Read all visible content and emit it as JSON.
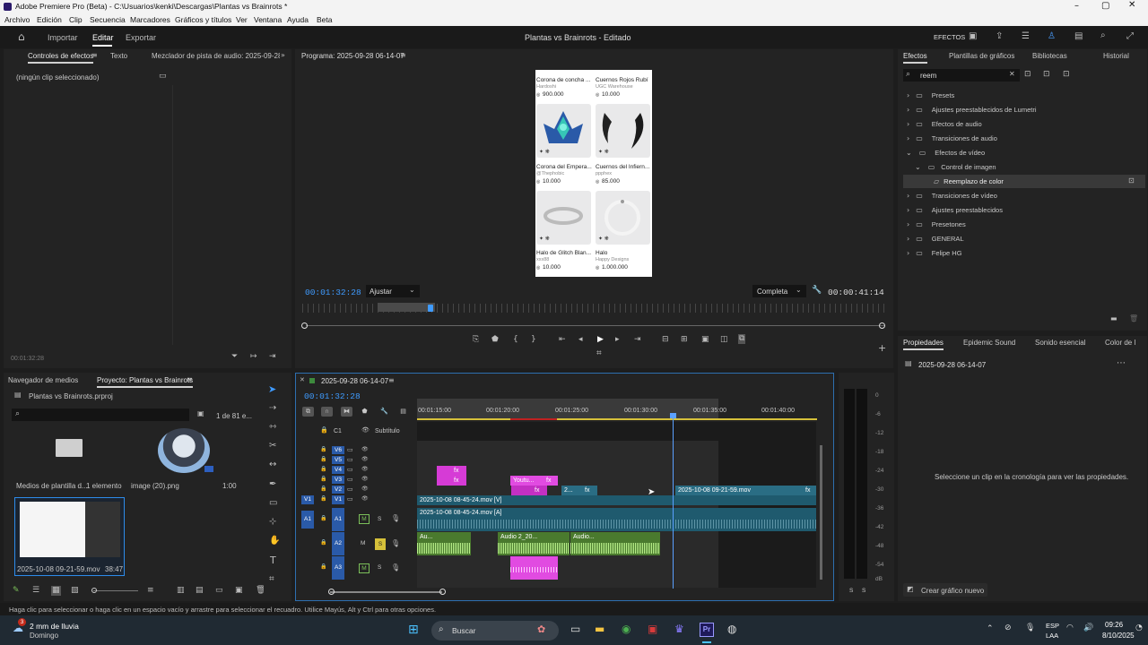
{
  "window": {
    "title": "Adobe Premiere Pro (Beta) - C:\\Usuarios\\kenki\\Descargas\\Plantas vs Brainrots *",
    "menu": [
      "Archivo",
      "Edición",
      "Clip",
      "Secuencia",
      "Marcadores",
      "Gráficos y títulos",
      "Ver",
      "Ventana",
      "Ayuda",
      "Beta"
    ]
  },
  "header": {
    "nav": [
      "Importar",
      "Editar",
      "Exportar"
    ],
    "project_title": "Plantas vs Brainrots - Editado",
    "workspace_label": "EFECTOS"
  },
  "effect_controls": {
    "tabs": [
      "Controles de efectos",
      "Texto",
      "Mezclador de pista de audio: 2025-09-28 0("
    ],
    "empty_msg": "(ningún clip seleccionado)",
    "timecode": "00:01:32:28"
  },
  "program": {
    "title": "Programa: 2025-09-28 06-14-07",
    "timecode_left": "00:01:32:28",
    "fit": "Ajustar",
    "quality": "Completa",
    "timecode_right": "00:00:41:14",
    "items": [
      {
        "name": "Corona de concha ...",
        "seller": "Hardoshi",
        "price": "900.000"
      },
      {
        "name": "Cuernos Rojos Rubí",
        "seller": "UGC Warehouse",
        "price": "10.000"
      },
      {
        "name": "Corona del Empera...",
        "seller": "@Thephobic",
        "price": "10.000"
      },
      {
        "name": "Cuernos del Infiern...",
        "seller": "ppphex",
        "price": "85.000"
      },
      {
        "name": "Halo de Glitch Blan...",
        "seller": "xxx88",
        "price": "10.000"
      },
      {
        "name": "Halo",
        "seller": "Happy Designs",
        "price": "1.000.000"
      }
    ]
  },
  "effects": {
    "tabs": [
      "Efectos",
      "Plantillas de gráficos",
      "Bibliotecas",
      "Historial"
    ],
    "search_value": "reem",
    "tree": [
      {
        "label": "Presets",
        "level": 0,
        "open": false
      },
      {
        "label": "Ajustes preestablecidos de Lumetri",
        "level": 0,
        "open": false
      },
      {
        "label": "Efectos de audio",
        "level": 0,
        "open": false
      },
      {
        "label": "Transiciones de audio",
        "level": 0,
        "open": false
      },
      {
        "label": "Efectos de vídeo",
        "level": 0,
        "open": true
      },
      {
        "label": "Control de imagen",
        "level": 1,
        "open": true
      },
      {
        "label": "Reemplazo de color",
        "level": 2,
        "open": false
      },
      {
        "label": "Transiciones de vídeo",
        "level": 0,
        "open": false
      },
      {
        "label": "Ajustes preestablecidos",
        "level": 0,
        "open": false
      },
      {
        "label": "Presetones",
        "level": 0,
        "open": false
      },
      {
        "label": "GENERAL",
        "level": 0,
        "open": false
      },
      {
        "label": "Felipe HG",
        "level": 0,
        "open": false
      }
    ]
  },
  "properties": {
    "tabs": [
      "Propiedades",
      "Epidemic Sound",
      "Sonido esencial",
      "Color de l"
    ],
    "sequence": "2025-09-28 06-14-07",
    "empty_msg": "Seleccione un clip en la cronología para ver las propiedades.",
    "new_graphic": "Crear gráfico nuevo"
  },
  "project": {
    "tabs": [
      "Navegador de medios",
      "Proyecto: Plantas vs Brainrots"
    ],
    "file": "Plantas vs Brainrots.prproj",
    "count": "1 de 81 e...",
    "items": [
      {
        "name": "Medios de plantilla d...",
        "info": "1 elemento"
      },
      {
        "name": "image (20).png",
        "info": "1:00"
      },
      {
        "name": "2025-10-08 09-21-59.mov",
        "info": "38:47"
      }
    ]
  },
  "timeline": {
    "title": "2025-09-28 06-14-07",
    "timecode": "00:01:32:28",
    "ruler": [
      "00:01:15:00",
      "00:01:20:00",
      "00:01:25:00",
      "00:01:30:00",
      "00:01:35:00",
      "00:01:40:00"
    ],
    "subtitle": "Subtítulo",
    "c1": "C1",
    "tracks": [
      "V6",
      "V5",
      "V4",
      "V3",
      "V2",
      "V1",
      "A1",
      "A2",
      "A3"
    ],
    "clips": {
      "v3": "Youtu...",
      "v2_short": "2...",
      "v1_a": "2025-10-08 08-45-24.mov [V]",
      "v1_b": "2025-10-08 09-21-59.mov",
      "a1": "2025-10-08 08-45-24.mov [A]",
      "a2_a": "Au...",
      "a2_b": "Audio 2_20...",
      "a2_c": "Audio...",
      "fx": "fx"
    },
    "mute": "M",
    "solo": "S"
  },
  "meter": {
    "scale": [
      "0",
      "-6",
      "-12",
      "-18",
      "-24",
      "-30",
      "-36",
      "-42",
      "-48",
      "-54",
      "dB"
    ],
    "bottom": [
      "S",
      "S"
    ]
  },
  "status_bar": "Haga clic para seleccionar o haga clic en un espacio vacío y arrastre para seleccionar el recuadro. Utilice Mayús, Alt y Ctrl para otras opciones.",
  "taskbar": {
    "weather": "2 mm de lluvia",
    "day": "Domingo",
    "badge": "3",
    "search": "Buscar",
    "lang1": "ESP",
    "lang2": "LAA",
    "time": "09:26",
    "date": "8/10/2025"
  },
  "colors": {
    "accent_blue": "#2d8ceb",
    "clip_pink": "#d63bd6",
    "clip_teal": "#2a6d84",
    "audio_green": "#7cc05a"
  }
}
